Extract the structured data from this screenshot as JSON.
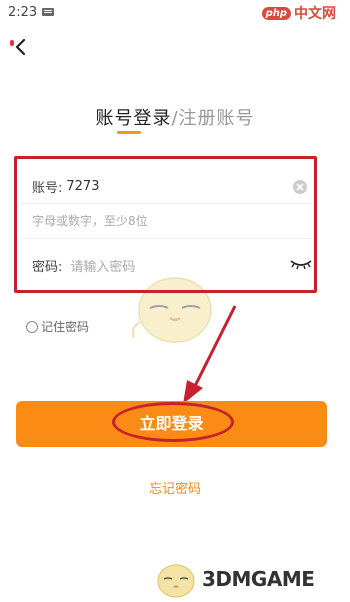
{
  "status_bar": {
    "time": "2:23"
  },
  "watermark_top": {
    "badge": "php",
    "text": "中文网"
  },
  "title": {
    "login_tab": "账号登录",
    "separator": "/",
    "register_tab": "注册账号"
  },
  "form": {
    "account_label": "账号:",
    "account_value": "7273",
    "account_hint": "字母或数字，至少8位",
    "password_label": "密码:",
    "password_placeholder": "请输入密码"
  },
  "remember_label": "记住密码",
  "login_button": "立即登录",
  "forgot_password": "忘记密码",
  "watermark_bottom": {
    "text": "3DMGAME"
  },
  "colors": {
    "accent": "#fa8c16",
    "annotation": "#c8202e",
    "link": "#f08a19"
  },
  "icons": [
    "back-arrow-icon",
    "clear-icon",
    "eye-closed-icon",
    "radio-icon"
  ]
}
